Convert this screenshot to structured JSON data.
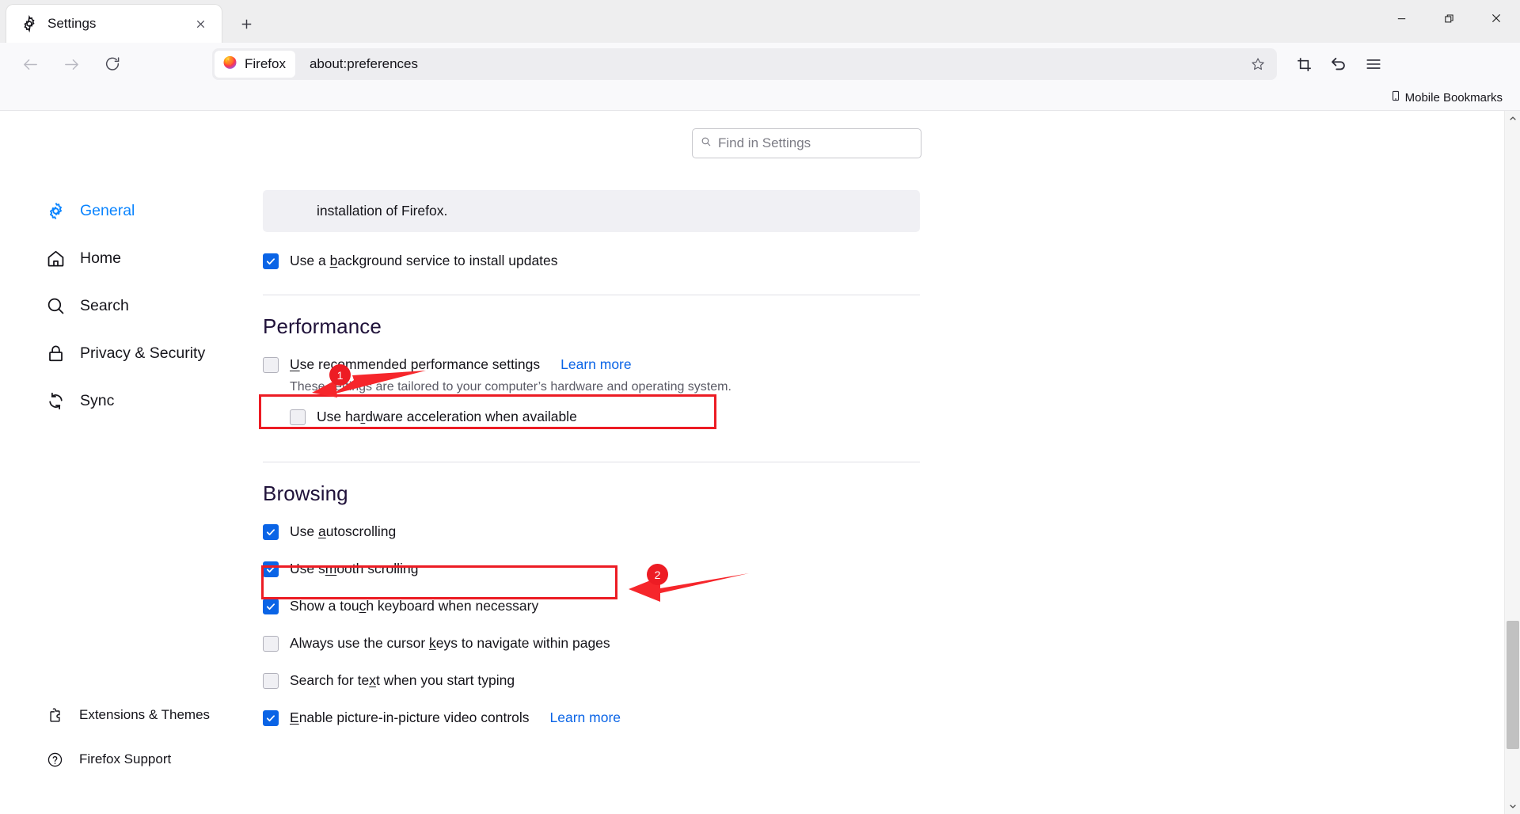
{
  "window": {
    "minimize_label": "minimize",
    "restore_label": "restore",
    "close_label": "close"
  },
  "tab": {
    "title": "Settings",
    "favicon": "gear-icon",
    "close_label": "×",
    "newtab_label": "+"
  },
  "toolbar": {
    "back_label": "back",
    "forward_label": "forward",
    "reload_label": "reload",
    "url_chip_label": "Firefox",
    "url": "about:preferences",
    "bookmark_star": "star-icon",
    "screenshot_label": "screenshot",
    "undo_label": "undo",
    "menu_label": "menu"
  },
  "bookmarks": {
    "items": [
      {
        "label": "Mobile Bookmarks",
        "icon": "mobile-device-icon"
      }
    ]
  },
  "search": {
    "placeholder": "Find in Settings"
  },
  "sidebar": {
    "items": [
      {
        "label": "General",
        "icon": "gear-icon",
        "selected": true
      },
      {
        "label": "Home",
        "icon": "home-icon",
        "selected": false
      },
      {
        "label": "Search",
        "icon": "search-icon",
        "selected": false
      },
      {
        "label": "Privacy & Security",
        "icon": "lock-icon",
        "selected": false
      },
      {
        "label": "Sync",
        "icon": "sync-icon",
        "selected": false
      }
    ],
    "bottom_items": [
      {
        "label": "Extensions & Themes",
        "icon": "puzzle-icon"
      },
      {
        "label": "Firefox Support",
        "icon": "question-circle-icon"
      }
    ]
  },
  "main": {
    "info_text": "installation of Firefox.",
    "background_service": {
      "label_pre": "Use a ",
      "label_key": "b",
      "label_post": "ackground service to install updates",
      "checked": true
    },
    "performance": {
      "title": "Performance",
      "recommended": {
        "label_pre": "",
        "label_key": "U",
        "label_post": "se recommended performance settings",
        "checked": false,
        "learn_more": "Learn more"
      },
      "description": "These settings are tailored to your computer’s hardware and operating system.",
      "hardware_accel": {
        "label_pre": "Use ha",
        "label_key": "r",
        "label_post": "dware acceleration when available",
        "checked": false
      }
    },
    "browsing": {
      "title": "Browsing",
      "options": [
        {
          "label_pre": "Use ",
          "label_key": "a",
          "label_post": "utoscrolling",
          "checked": true,
          "learn_more": ""
        },
        {
          "label_pre": "Use s",
          "label_key": "m",
          "label_post": "ooth scrolling",
          "checked": true,
          "learn_more": ""
        },
        {
          "label_pre": "Show a tou",
          "label_key": "c",
          "label_post": "h keyboard when necessary",
          "checked": true,
          "learn_more": ""
        },
        {
          "label_pre": "Always use the cursor ",
          "label_key": "k",
          "label_post": "eys to navigate within pages",
          "checked": false,
          "learn_more": ""
        },
        {
          "label_pre": "Search for te",
          "label_key": "x",
          "label_post": "t when you start typing",
          "checked": false,
          "learn_more": ""
        },
        {
          "label_pre": "",
          "label_key": "E",
          "label_post": "nable picture-in-picture video controls",
          "checked": true,
          "learn_more": "Learn more"
        }
      ]
    }
  },
  "annotations": {
    "accent_color": "#ed1c24",
    "markers": [
      {
        "number": "1",
        "target": "use-recommended-performance-settings-checkbox"
      },
      {
        "number": "2",
        "target": "use-hardware-acceleration-checkbox"
      }
    ]
  },
  "colors": {
    "link": "#0a64e6",
    "selected_nav": "#0a84ff",
    "checkbox_checked": "#0a64e6",
    "annotation_red": "#ed1c24"
  }
}
